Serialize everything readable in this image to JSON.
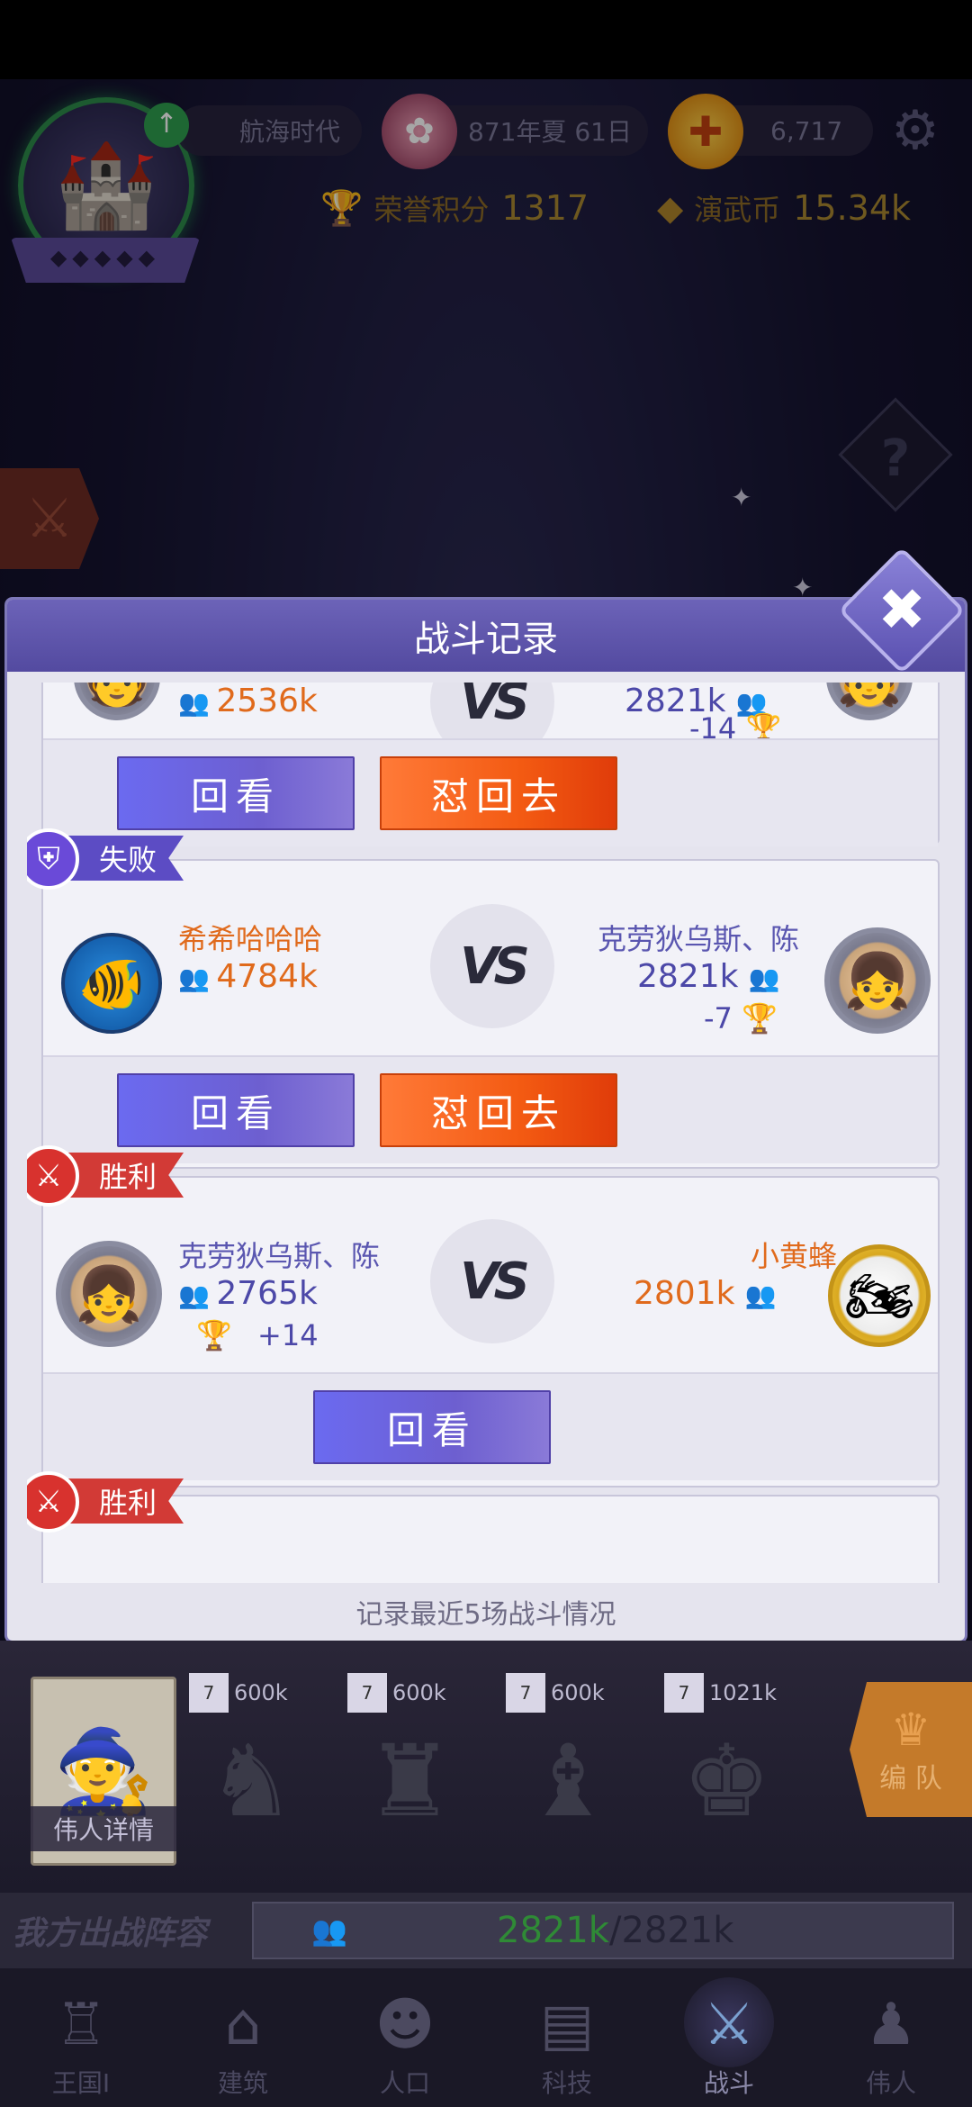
{
  "topbar": {
    "era_label": "航海时代",
    "date": "871年夏 61日",
    "coins": "6,717",
    "honor_label": "荣誉积分",
    "honor_value": "1317",
    "yanwu_label": "演武币",
    "yanwu_value": "15.34k",
    "emblem_dots": "◆◆◆◆◆"
  },
  "dialog": {
    "title": "战斗记录",
    "footer": "记录最近5场战斗情况",
    "records": [
      {
        "left_power": "2536k",
        "right_power": "2821k",
        "right_score": "-14",
        "buttons": [
          "回看",
          "怼回去"
        ]
      },
      {
        "result": "失败",
        "left_name": "希希哈哈哈",
        "left_power": "4784k",
        "right_name": "克劳狄乌斯、陈",
        "right_power": "2821k",
        "right_score": "-7",
        "vs": "VS",
        "buttons": [
          "回看",
          "怼回去"
        ]
      },
      {
        "result": "胜利",
        "left_name": "克劳狄乌斯、陈",
        "left_power": "2765k",
        "left_score": "+14",
        "right_name": "小黄蜂",
        "right_power": "2801k",
        "vs": "VS",
        "buttons": [
          "回看"
        ]
      },
      {
        "result": "胜利"
      }
    ]
  },
  "formation": {
    "hero_detail": "伟人详情",
    "formation_button": "编 队",
    "units": [
      {
        "level": "7",
        "power": "600k"
      },
      {
        "level": "7",
        "power": "600k"
      },
      {
        "level": "7",
        "power": "600k"
      },
      {
        "level": "7",
        "power": "1021k"
      }
    ]
  },
  "lineup": {
    "label": "我方出战阵容",
    "current": "2821k",
    "total": "/2821k"
  },
  "nav": {
    "items": [
      {
        "label": "王国I",
        "icon": "castle-icon"
      },
      {
        "label": "建筑",
        "icon": "house-icon"
      },
      {
        "label": "人口",
        "icon": "person-icon"
      },
      {
        "label": "科技",
        "icon": "book-icon"
      },
      {
        "label": "战斗",
        "icon": "swords-icon",
        "active": true
      },
      {
        "label": "伟人",
        "icon": "hero-icon"
      }
    ]
  },
  "colors": {
    "accent_purple": "#6b6af0",
    "accent_orange": "#f35a12",
    "lose_tag": "#5c4cc4",
    "win_tag": "#d23a36"
  }
}
